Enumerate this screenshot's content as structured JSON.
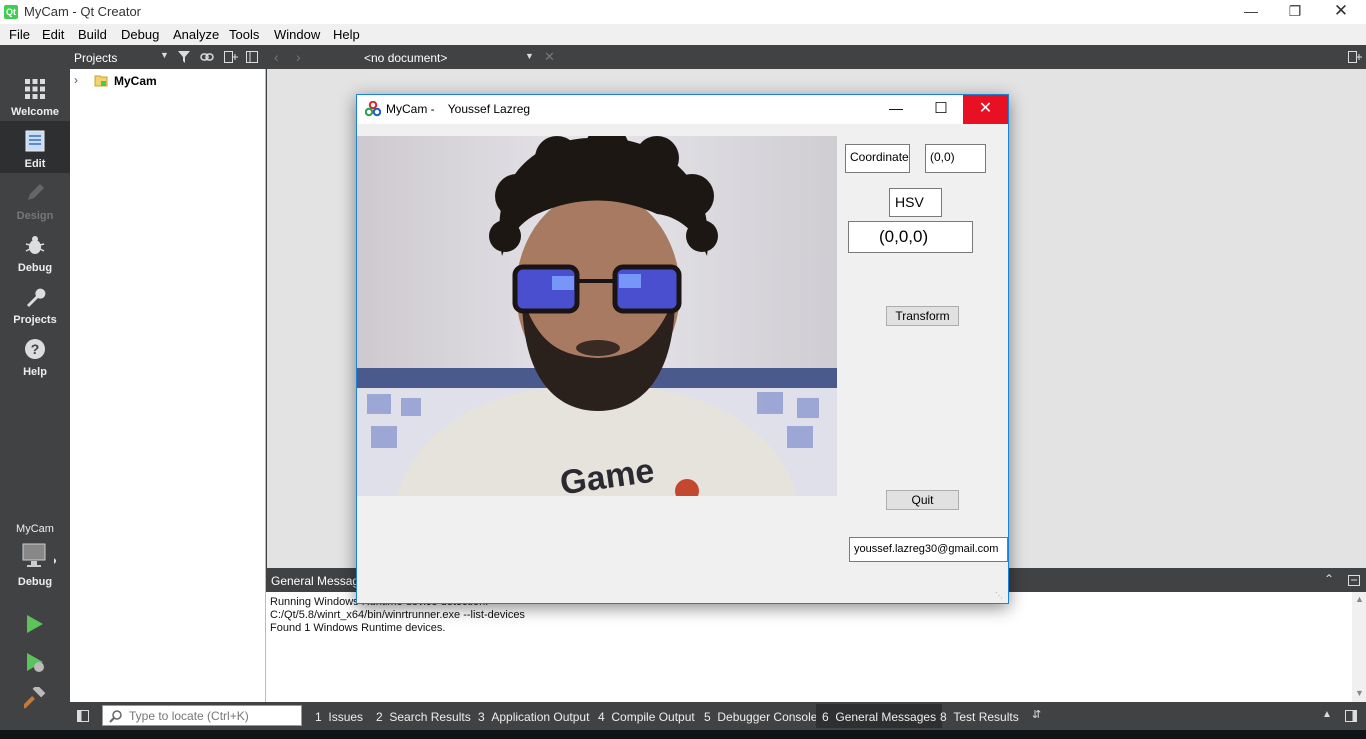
{
  "window": {
    "title": "MyCam - Qt Creator",
    "icon": "qt-creator-icon"
  },
  "menubar": [
    "File",
    "Edit",
    "Build",
    "Debug",
    "Analyze",
    "Tools",
    "Window",
    "Help"
  ],
  "modes": [
    {
      "label": "Welcome",
      "icon": "grid-icon"
    },
    {
      "label": "Edit",
      "icon": "document-edit-icon"
    },
    {
      "label": "Design",
      "icon": "pencil-icon"
    },
    {
      "label": "Debug",
      "icon": "bug-icon"
    },
    {
      "label": "Projects",
      "icon": "wrench-icon"
    },
    {
      "label": "Help",
      "icon": "help-icon"
    }
  ],
  "kit": {
    "project": "MyCam",
    "mode": "Debug"
  },
  "sidebar": {
    "selector": "Projects",
    "tree": [
      {
        "name": "MyCam",
        "expanded": false
      }
    ]
  },
  "editor": {
    "document_selector": "<no document>"
  },
  "output": {
    "title": "General Messages",
    "lines": [
      "Running Windows Runtime device detection.",
      "C:/Qt/5.8/winrt_x64/bin/winrtrunner.exe --list-devices",
      "Found 1 Windows Runtime devices."
    ]
  },
  "statusbar": {
    "locator_placeholder": "Type to locate (Ctrl+K)",
    "tabs": [
      {
        "num": "1",
        "label": "Issues"
      },
      {
        "num": "2",
        "label": "Search Results"
      },
      {
        "num": "3",
        "label": "Application Output"
      },
      {
        "num": "4",
        "label": "Compile Output"
      },
      {
        "num": "5",
        "label": "Debugger Console"
      },
      {
        "num": "6",
        "label": "General Messages",
        "active": true
      },
      {
        "num": "8",
        "label": "Test Results"
      }
    ]
  },
  "dialog": {
    "title": "MyCam -    Youssef Lazreg",
    "coordinate_label": "Coordinate",
    "coordinate_value": "(0,0)",
    "hsv_label": "HSV",
    "hsv_value": "(0,0,0)",
    "transform_button": "Transform",
    "quit_button": "Quit",
    "email": "youssef.lazreg30@gmail.com",
    "camera_shirt_text": "Game"
  },
  "colors": {
    "qt_green": "#41cd52",
    "close_red": "#e81123",
    "accent_blue": "#1883d7",
    "run_green": "#5cc25a"
  }
}
